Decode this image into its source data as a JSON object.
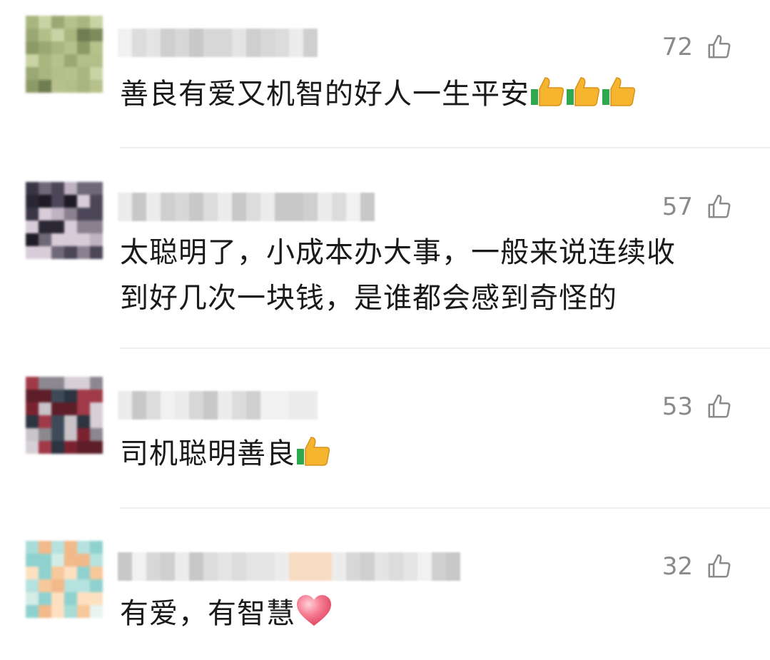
{
  "comments": [
    {
      "likes": "72",
      "text": "善良有爱又机智的好人一生平安",
      "emojis": [
        "thumbs-up",
        "thumbs-up",
        "thumbs-up"
      ]
    },
    {
      "likes": "57",
      "text_line1": "太聪明了，小成本办大事，一般来说连续收",
      "text_line2": "到好几次一块钱，是谁都会感到奇怪的",
      "emojis": []
    },
    {
      "likes": "53",
      "text": "司机聪明善良",
      "emojis": [
        "thumbs-up"
      ]
    },
    {
      "likes": "32",
      "text": "有爱，有智慧",
      "emojis": [
        "heart"
      ]
    }
  ],
  "colors": {
    "text": "#1a1a1a",
    "likes": "#8a8a8a",
    "divider": "#eeeeee",
    "heart": "#f06a7e",
    "thumb": "#f5b52e"
  }
}
